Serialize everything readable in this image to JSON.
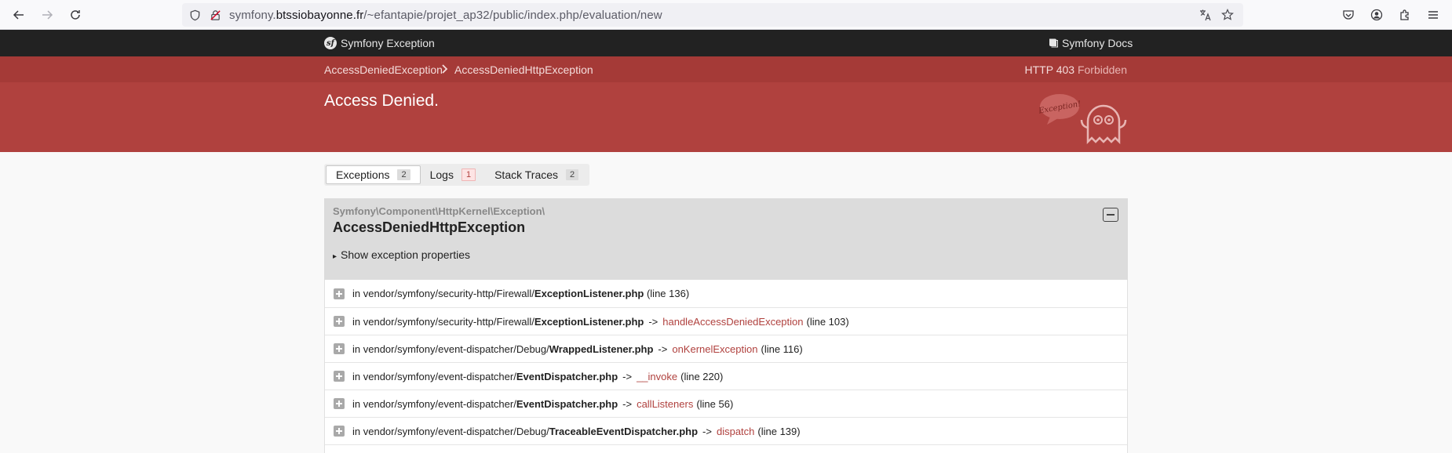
{
  "browser": {
    "url_prefix": "symfony.",
    "url_domain": "btssiobayonne.fr",
    "url_path": "/~efantapie/projet_ap32/public/index.php/evaluation/new"
  },
  "symfony": {
    "brand": "Symfony Exception",
    "docs": "Symfony Docs",
    "crumbs": [
      "AccessDeniedException",
      "AccessDeniedHttpException"
    ],
    "http_code": "HTTP 403",
    "http_status": "Forbidden",
    "title": "Access Denied.",
    "ghost_text": "Exception!"
  },
  "tabs": [
    {
      "label": "Exceptions",
      "count": "2"
    },
    {
      "label": "Logs",
      "count": "1"
    },
    {
      "label": "Stack Traces",
      "count": "2"
    }
  ],
  "exception": {
    "namespace": "Symfony\\Component\\HttpKernel\\Exception\\",
    "class": "AccessDeniedHttpException",
    "props_label": "Show exception properties"
  },
  "trace": [
    {
      "path": "in vendor/symfony/security-http/Firewall/",
      "file": "ExceptionListener.php",
      "arrow": "",
      "func": "",
      "line": "(line 136)"
    },
    {
      "path": "in vendor/symfony/security-http/Firewall/",
      "file": "ExceptionListener.php",
      "arrow": "->",
      "func": "handleAccessDeniedException",
      "line": "(line 103)"
    },
    {
      "path": "in vendor/symfony/event-dispatcher/Debug/",
      "file": "WrappedListener.php",
      "arrow": "->",
      "func": "onKernelException",
      "line": "(line 116)"
    },
    {
      "path": "in vendor/symfony/event-dispatcher/",
      "file": "EventDispatcher.php",
      "arrow": "->",
      "func": "__invoke",
      "line": "(line 220)"
    },
    {
      "path": "in vendor/symfony/event-dispatcher/",
      "file": "EventDispatcher.php",
      "arrow": "->",
      "func": "callListeners",
      "line": "(line 56)"
    },
    {
      "path": "in vendor/symfony/event-dispatcher/Debug/",
      "file": "TraceableEventDispatcher.php",
      "arrow": "->",
      "func": "dispatch",
      "line": "(line 139)"
    },
    {
      "path": "",
      "file": "",
      "arrow": "",
      "func": "",
      "line": ""
    }
  ]
}
